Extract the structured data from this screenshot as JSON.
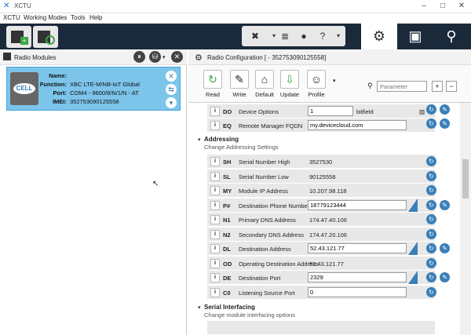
{
  "window": {
    "title": "XCTU",
    "minimize": "–",
    "maximize": "□",
    "close": "✕"
  },
  "menu": [
    "XCTU",
    "Working Modes",
    "Tools",
    "Help"
  ],
  "toolbar": {
    "tabs": [
      "config",
      "console",
      "network"
    ]
  },
  "left_panel": {
    "title": "Radio Modules",
    "module": {
      "name_label": "Name:",
      "name_value": "",
      "function_label": "Function:",
      "function_value": "XBC LTE-M/NB-IoT Global",
      "port_label": "Port:",
      "port_value": "COM4 - 9600/8/N/1/N - AT",
      "imei_label": "IMEI:",
      "imei_value": "352753090125558",
      "icon_text": "CELL"
    }
  },
  "right_panel": {
    "title": "Radio Configuration [ - 352753090125558]",
    "actions": [
      "Read",
      "Write",
      "Default",
      "Update",
      "Profile"
    ],
    "search_placeholder": "Parameter",
    "rows_top": [
      {
        "code": "DO",
        "name": "Device Options",
        "value": "1",
        "suffix": "bitfield"
      },
      {
        "code": "EQ",
        "name": "Remote Manager FQDN",
        "value": "my.devicecloud.com"
      }
    ],
    "addressing": {
      "title": "Addressing",
      "subtitle": "Change Addressing Settings",
      "rows": [
        {
          "code": "SH",
          "name": "Serial Number High",
          "value": "3527530"
        },
        {
          "code": "SL",
          "name": "Serial Number Low",
          "value": "90125558"
        },
        {
          "code": "MY",
          "name": "Module IP Address",
          "value": "10.207.98.118"
        },
        {
          "code": "P#",
          "name": "Destination Phone Number",
          "value": "18779123444"
        },
        {
          "code": "N1",
          "name": "Primary DNS Address",
          "value": "174.47.40.106"
        },
        {
          "code": "N2",
          "name": "Secondary DNS Address",
          "value": "174.47.20.106"
        },
        {
          "code": "DL",
          "name": "Destination Address",
          "value": "52.43.121.77"
        },
        {
          "code": "OD",
          "name": "Operating Destination Address",
          "value": "52.43.121.77"
        },
        {
          "code": "DE",
          "name": "Destination Port",
          "value": "2329"
        },
        {
          "code": "C0",
          "name": "Listening Source Port",
          "value": "0"
        }
      ]
    },
    "serial": {
      "title": "Serial Interfacing",
      "subtitle": "Change module interfacing options"
    }
  }
}
